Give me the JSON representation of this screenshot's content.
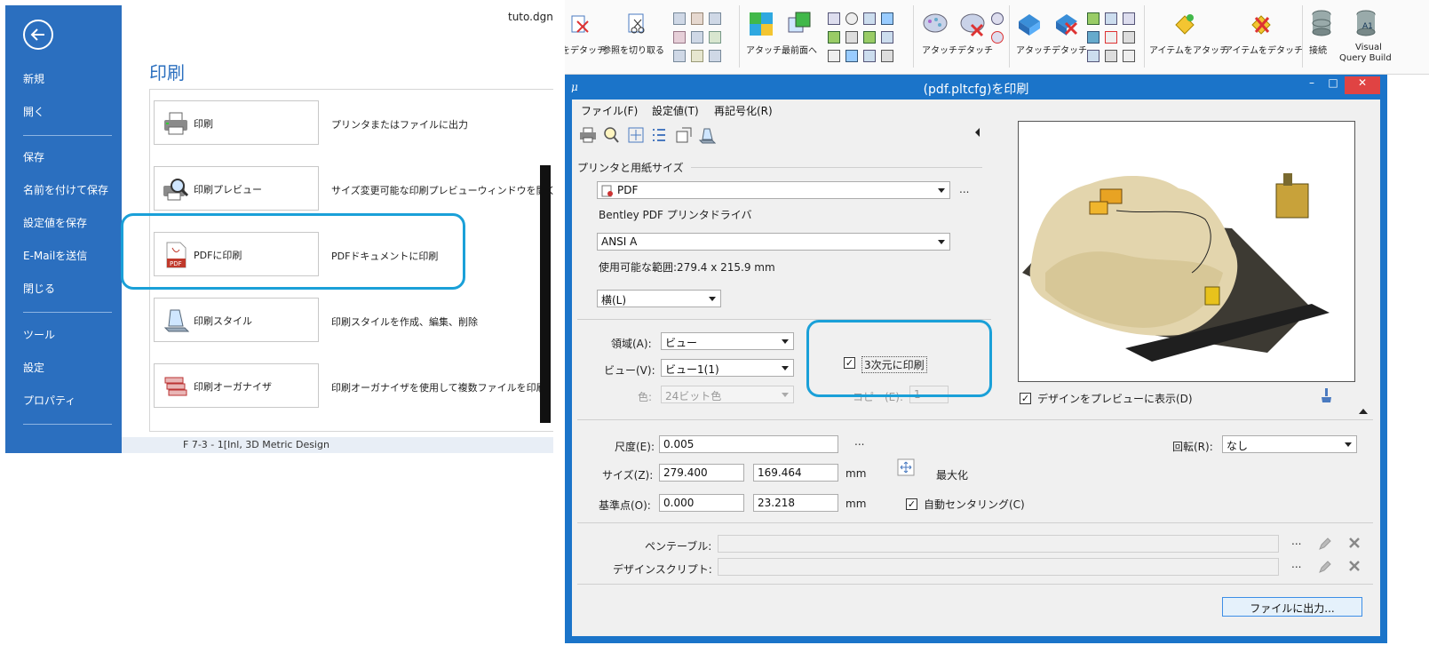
{
  "backstage": {
    "doc_title": "tuto.dgn",
    "heading": "印刷",
    "nav": [
      "新規",
      "開く",
      "保存",
      "名前を付けて保存",
      "設定値を保存",
      "E-Mailを送信",
      "閉じる",
      "ツール",
      "設定",
      "プロパティ"
    ],
    "items": [
      {
        "label": "印刷",
        "desc": "プリンタまたはファイルに出力"
      },
      {
        "label": "印刷プレビュー",
        "desc": "サイズ変更可能な印刷プレビューウィンドウを開く"
      },
      {
        "label": "PDFに印刷",
        "desc": "PDFドキュメントに印刷"
      },
      {
        "label": "印刷スタイル",
        "desc": "印刷スタイルを作成、編集、削除"
      },
      {
        "label": "印刷オーガナイザ",
        "desc": "印刷オーガナイザを使用して複数ファイルを印刷"
      }
    ],
    "bottom_text": "F 7-3 - 1[Inl, 3D Metric Design"
  },
  "ribbon": {
    "items": [
      "をデタッチ",
      "参照を切り取る",
      "アタッチ",
      "最前面へ",
      "アタッチ",
      "デタッチ",
      "アタッチ",
      "デタッチ",
      "アイテムをアタッチ",
      "アイテムをデタッチ",
      "接続",
      "Visual",
      "Query Build"
    ]
  },
  "dialog": {
    "title": "(pdf.pltcfg)を印刷",
    "menus": [
      "ファイル(F)",
      "設定値(T)",
      "再記号化(R)"
    ],
    "printer_section": "プリンタと用紙サイズ",
    "printer": "PDF",
    "driver": "Bentley PDF プリンタドライバ",
    "paper": "ANSI A",
    "usable_area": "使用可能な範囲:279.4 x 215.9 mm",
    "orientation": "横(L)",
    "area_label": "領域(A):",
    "area_value": "ビュー",
    "view_label": "ビュー(V):",
    "view_value": "ビュー1(1)",
    "color_label": "色:",
    "color_value": "24ビット色",
    "print3d_label": "3次元に印刷",
    "copies_label": "コピー(E):",
    "copies_value": "1",
    "preview_label": "デザインをプレビューに表示(D)",
    "scale_label": "尺度(E):",
    "scale_value": "0.005",
    "rotation_label": "回転(R):",
    "rotation_value": "なし",
    "size_label": "サイズ(Z):",
    "size_w": "279.400",
    "size_h": "169.464",
    "unit_mm": "mm",
    "maximize_label": "最大化",
    "origin_label": "基準点(O):",
    "origin_x": "0.000",
    "origin_y": "23.218",
    "autocenter_label": "自動センタリング(C)",
    "pentable_label": "ペンテーブル:",
    "designscript_label": "デザインスクリプト:",
    "ellipsis": "...",
    "output_button": "ファイルに出力..."
  },
  "colors": {
    "accent": "#2b6fbf",
    "highlight": "#1aa0d8",
    "dialog_frame": "#1b74c9",
    "close_red": "#e04343"
  }
}
